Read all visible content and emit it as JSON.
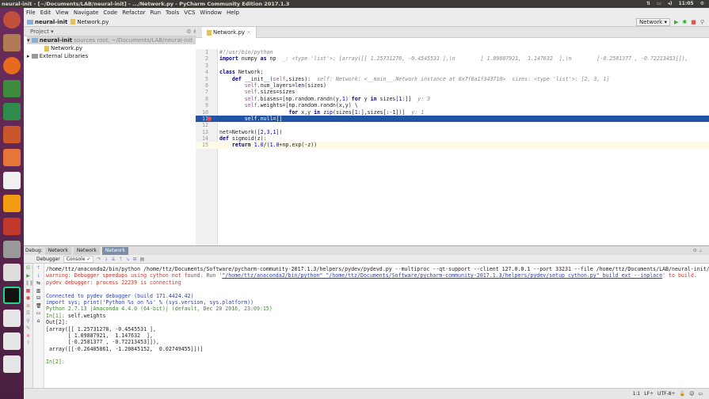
{
  "window": {
    "title": "neural-init - [~/Documents/LAB/neural-init] - .../Network.py - PyCharm Community Edition 2017.1.3",
    "time": "11:05"
  },
  "menu": [
    "File",
    "Edit",
    "View",
    "Navigate",
    "Code",
    "Refactor",
    "Run",
    "Tools",
    "VCS",
    "Window",
    "Help"
  ],
  "breadcrumb": [
    "neural-init",
    "Network.py"
  ],
  "run_config": "Network",
  "project": {
    "header": "Project",
    "root": "neural-init",
    "root_hint": "sources root, ~/Documents/LAB/neural-init",
    "file": "Network.py",
    "libs": "External Libraries"
  },
  "editor": {
    "tab": "Network.py",
    "lines": [
      [
        [
          "#!/usr/bin/python",
          "cm"
        ]
      ],
      [
        [
          "import",
          "kw"
        ],
        [
          " numpy ",
          ""
        ],
        [
          "as",
          "kw"
        ],
        [
          " np  ",
          ""
        ],
        [
          "_: <type 'list'>: [array([[ 1.25731278, -0.4545531 ],\\n        [ 1.09887921,  1.147632  ],\\n        [-0.2581377 , -0.72213453]]),",
          "hint"
        ]
      ],
      [],
      [
        [
          "class",
          "kw"
        ],
        [
          " Network:",
          ""
        ]
      ],
      [
        [
          "    ",
          ""
        ],
        [
          "def",
          "kw"
        ],
        [
          " __init__(",
          ""
        ],
        [
          "self",
          "sf"
        ],
        [
          ",sizes):  ",
          ""
        ],
        [
          "self: Network: <__main__.Network instance at 0x7f0a1f343710>  sizes: <type 'list'>: [2, 3, 1]",
          "hint"
        ]
      ],
      [
        [
          "        ",
          ""
        ],
        [
          "self",
          "sf"
        ],
        [
          ".num_layers=",
          ""
        ],
        [
          "len",
          "bi"
        ],
        [
          "(sizes)",
          ""
        ]
      ],
      [
        [
          "        ",
          ""
        ],
        [
          "self",
          "sf"
        ],
        [
          ".sizes=sizes",
          ""
        ]
      ],
      [
        [
          "        ",
          ""
        ],
        [
          "self",
          "sf"
        ],
        [
          ".biases=[np.random.randn(y,",
          ""
        ],
        [
          "1",
          "num"
        ],
        [
          ") ",
          ""
        ],
        [
          "for",
          "kw"
        ],
        [
          " y ",
          ""
        ],
        [
          "in",
          "kw"
        ],
        [
          " sizes[",
          ""
        ],
        [
          "1",
          "num"
        ],
        [
          ":]]  ",
          ""
        ],
        [
          "y: 3",
          "hint"
        ]
      ],
      [
        [
          "        ",
          ""
        ],
        [
          "self",
          "sf"
        ],
        [
          ".weights=[np.random.randn(x,y) \\",
          ""
        ]
      ],
      [
        [
          "                      ",
          ""
        ],
        [
          "for",
          "kw"
        ],
        [
          " x,y ",
          ""
        ],
        [
          "in",
          "kw"
        ],
        [
          " ",
          ""
        ],
        [
          "zip",
          "bi"
        ],
        [
          "(sizes[",
          ""
        ],
        [
          "1",
          "num"
        ],
        [
          ":],sizes[:-",
          ""
        ],
        [
          "1",
          "num"
        ],
        [
          "])]  ",
          ""
        ],
        [
          "y: 1",
          "hint"
        ]
      ],
      [
        [
          "        self.null=[]",
          ""
        ]
      ],
      [],
      [
        [
          "net=Network([",
          ""
        ],
        [
          "2",
          "num"
        ],
        [
          ",",
          ""
        ],
        [
          "3",
          "num"
        ],
        [
          ",",
          ""
        ],
        [
          "1",
          "num"
        ],
        [
          "])",
          ""
        ]
      ],
      [
        [
          "def",
          "kw"
        ],
        [
          " sigmoid(z):",
          ""
        ]
      ],
      [
        [
          "    ",
          ""
        ],
        [
          "return",
          "kw"
        ],
        [
          " ",
          ""
        ],
        [
          "1.0",
          "num"
        ],
        [
          "/(",
          ""
        ],
        [
          "1.0",
          "num"
        ],
        [
          "+np.exp(-z))",
          ""
        ]
      ]
    ]
  },
  "debug": {
    "label": "Debug:",
    "tabs": [
      "Network",
      "Network",
      "Network"
    ],
    "debugger_tab": "Debugger",
    "console_tab": "Console",
    "console": [
      [
        [
          "/home/ttz/anaconda2/bin/python /home/ttz/Documents/Software/pycharm-community-2017.1.3/helpers/pydev/pydevd.py --multiproc --qt-support --client 127.0.0.1 --port 33231 --file /home/ttz/Documents/LAB/neural-init/Network.py",
          ""
        ]
      ],
      [
        [
          "warning: Debugger speedups using cython not found. Run '",
          "err"
        ],
        [
          "\"/home/ttz/anaconda2/bin/python\" \"/home/ttz/Documents/Software/pycharm-community-2017.1.3/helpers/pydev/setup_cython.py\" build_ext --inplace",
          "lnk"
        ],
        [
          "' to build.",
          "err"
        ]
      ],
      [
        [
          "pydev debugger: process 22239 is connecting",
          "err"
        ]
      ],
      [],
      [
        [
          "Connected to pydev debugger (build 171.4424.42)",
          "blue"
        ]
      ],
      [
        [
          "import sys; print('Python %s on %s' % (sys.version, sys.platform))",
          "blue"
        ]
      ],
      [
        [
          "Python 2.7.13 |Anaconda 4.4.0 (64-bit)| (default, Dec 20 2016, 23:09:15)",
          "green"
        ]
      ],
      [
        [
          "In[1]: ",
          "green"
        ],
        [
          "self.weights",
          ""
        ]
      ],
      [
        [
          "Out[2]:",
          ""
        ]
      ],
      [
        [
          "[array([[ 1.25731278, -0.4545531 ],",
          ""
        ]
      ],
      [
        [
          "       [ 1.09887921,  1.147632  ],",
          ""
        ]
      ],
      [
        [
          "       [-0.2581377 , -0.72213453]]),",
          ""
        ]
      ],
      [
        [
          " array([[-0.26405861, -1.20845152,  0.02749455]])]",
          ""
        ]
      ],
      [],
      [
        [
          "In[2]: ",
          "green"
        ]
      ]
    ]
  },
  "status": {
    "position": "1:1",
    "line_sep": "LF÷",
    "encoding": "UTF-8÷"
  },
  "colors": {
    "launcher": "#5e2750",
    "selection": "#2154a5",
    "titlebar": "#3c3b37"
  }
}
